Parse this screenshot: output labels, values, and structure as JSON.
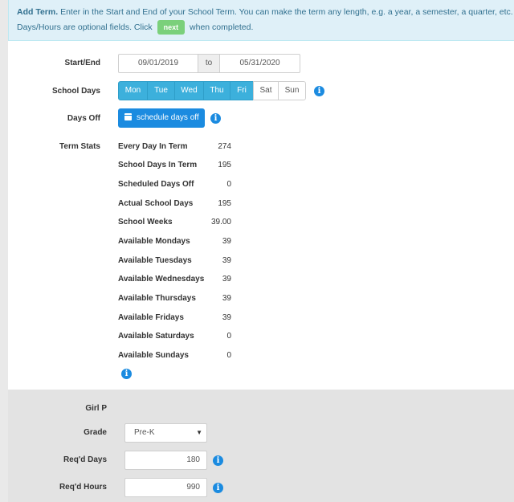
{
  "alert": {
    "title": "Add Term.",
    "text1": "Enter in the Start and End of your School Term. You can make the term any length, e.g. a year, a semester, a quarter, etc. Select ea",
    "text2_before": "Days/Hours are optional fields. Click",
    "next_label": "next",
    "text2_after": "when completed."
  },
  "labels": {
    "start_end": "Start/End",
    "school_days": "School Days",
    "days_off": "Days Off",
    "term_stats": "Term Stats"
  },
  "dates": {
    "start": "09/01/2019",
    "to": "to",
    "end": "05/31/2020"
  },
  "days": [
    {
      "label": "Mon",
      "selected": true
    },
    {
      "label": "Tue",
      "selected": true
    },
    {
      "label": "Wed",
      "selected": true
    },
    {
      "label": "Thu",
      "selected": true
    },
    {
      "label": "Fri",
      "selected": true
    },
    {
      "label": "Sat",
      "selected": false
    },
    {
      "label": "Sun",
      "selected": false
    }
  ],
  "schedule_button": "schedule days off",
  "stats": [
    {
      "name": "Every Day In Term",
      "value": "274"
    },
    {
      "name": "School Days In Term",
      "value": "195"
    },
    {
      "name": "Scheduled Days Off",
      "value": "0"
    },
    {
      "name": "Actual School Days",
      "value": "195"
    },
    {
      "name": "School Weeks",
      "value": "39.00"
    },
    {
      "name": "Available Mondays",
      "value": "39"
    },
    {
      "name": "Available Tuesdays",
      "value": "39"
    },
    {
      "name": "Available Wednesdays",
      "value": "39"
    },
    {
      "name": "Available Thursdays",
      "value": "39"
    },
    {
      "name": "Available Fridays",
      "value": "39"
    },
    {
      "name": "Available Saturdays",
      "value": "0"
    },
    {
      "name": "Available Sundays",
      "value": "0"
    }
  ],
  "student": {
    "name": "Girl P",
    "grade_label": "Grade",
    "grade_value": "Pre-K",
    "reqd_days_label": "Req'd Days",
    "reqd_days_value": "180",
    "reqd_hours_label": "Req'd Hours",
    "reqd_hours_value": "990"
  },
  "colors": {
    "accent": "#3cb0dc",
    "primary": "#1b8be0",
    "alert_bg": "#dff0f8",
    "next_green": "#7bd07b"
  },
  "icons": {
    "info": "info-icon",
    "calendar": "calendar-icon",
    "caret": "caret-down-icon"
  }
}
